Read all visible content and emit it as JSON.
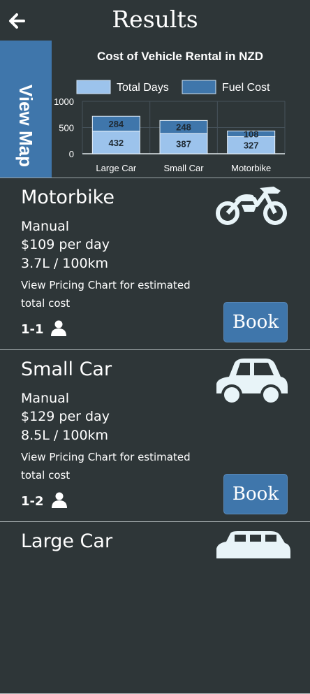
{
  "header": {
    "title": "Results",
    "back_icon": "arrow-left-icon"
  },
  "view_map": {
    "label": "View Map"
  },
  "colors": {
    "background": "#2e3638",
    "accent": "#3f76ab",
    "total_days": "#9cc3ec",
    "fuel_cost": "#3f76ab"
  },
  "chart_data": {
    "type": "bar",
    "stacked": true,
    "title": "Cost of Vehicle Rental in NZD",
    "categories": [
      "Large Car",
      "Small Car",
      "Motorbike"
    ],
    "series": [
      {
        "name": "Total Days",
        "values": [
          432,
          387,
          327
        ]
      },
      {
        "name": "Fuel Cost",
        "values": [
          284,
          248,
          108
        ]
      }
    ],
    "yticks": [
      "0",
      "500",
      "1000"
    ],
    "ylim": [
      0,
      1000
    ],
    "grid": true,
    "legend": "top"
  },
  "vehicles": [
    {
      "name": "Motorbike",
      "transmission": "Manual",
      "price": "$109 per day",
      "fuel": "3.7L / 100km",
      "note": "View Pricing Chart for estimated total cost",
      "passengers": "1-1",
      "book_label": "Book",
      "icon": "motorbike-icon"
    },
    {
      "name": "Small Car",
      "transmission": "Manual",
      "price": "$129 per day",
      "fuel": "8.5L / 100km",
      "note": "View Pricing Chart for estimated total cost",
      "passengers": "1-2",
      "book_label": "Book",
      "icon": "small-car-icon"
    },
    {
      "name": "Large Car",
      "icon": "large-car-icon"
    }
  ]
}
